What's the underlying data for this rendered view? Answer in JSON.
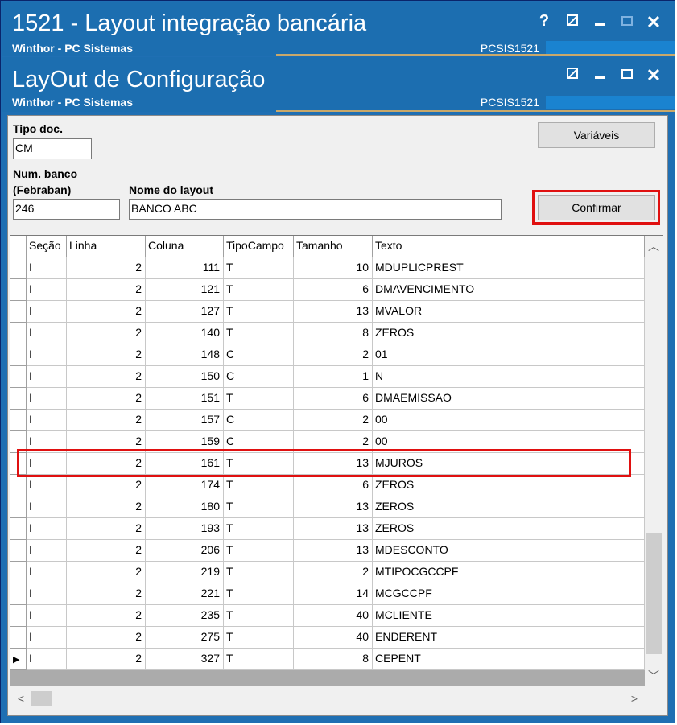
{
  "outer_window": {
    "title": "1521 - Layout integração bancária",
    "subtitle": "Winthor - PC Sistemas",
    "code": "PCSIS1521",
    "help_label": "?"
  },
  "inner_window": {
    "title": "LayOut de Configuração",
    "subtitle": "Winthor - PC Sistemas",
    "code": "PCSIS1521"
  },
  "form": {
    "tipo_doc_label": "Tipo doc.",
    "tipo_doc_value": "CM",
    "num_banco_label_1": "Num. banco",
    "num_banco_label_2": "(Febraban)",
    "num_banco_value": "246",
    "nome_layout_label": "Nome do layout",
    "nome_layout_value": "BANCO ABC",
    "variaveis_label": "Variáveis",
    "confirmar_label": "Confirmar"
  },
  "grid": {
    "columns": [
      "Seção",
      "Linha",
      "Coluna",
      "TipoCampo",
      "Tamanho",
      "Texto"
    ],
    "rows": [
      [
        "I",
        "2",
        "111",
        "T",
        "10",
        "MDUPLICPREST"
      ],
      [
        "I",
        "2",
        "121",
        "T",
        "6",
        "DMAVENCIMENTO"
      ],
      [
        "I",
        "2",
        "127",
        "T",
        "13",
        "MVALOR"
      ],
      [
        "I",
        "2",
        "140",
        "T",
        "8",
        "ZEROS"
      ],
      [
        "I",
        "2",
        "148",
        "C",
        "2",
        "01"
      ],
      [
        "I",
        "2",
        "150",
        "C",
        "1",
        "N"
      ],
      [
        "I",
        "2",
        "151",
        "T",
        "6",
        "DMAEMISSAO"
      ],
      [
        "I",
        "2",
        "157",
        "C",
        "2",
        "00"
      ],
      [
        "I",
        "2",
        "159",
        "C",
        "2",
        "00"
      ],
      [
        "I",
        "2",
        "161",
        "T",
        "13",
        "MJUROS"
      ],
      [
        "I",
        "2",
        "174",
        "T",
        "6",
        "ZEROS"
      ],
      [
        "I",
        "2",
        "180",
        "T",
        "13",
        "ZEROS"
      ],
      [
        "I",
        "2",
        "193",
        "T",
        "13",
        "ZEROS"
      ],
      [
        "I",
        "2",
        "206",
        "T",
        "13",
        "MDESCONTO"
      ],
      [
        "I",
        "2",
        "219",
        "T",
        "2",
        "MTIPOCGCCPF"
      ],
      [
        "I",
        "2",
        "221",
        "T",
        "14",
        "MCGCCPF"
      ],
      [
        "I",
        "2",
        "235",
        "T",
        "40",
        "MCLIENTE"
      ],
      [
        "I",
        "2",
        "275",
        "T",
        "40",
        "ENDERENT"
      ],
      [
        "I",
        "2",
        "327",
        "T",
        "8",
        "CEPENT"
      ]
    ],
    "highlighted_row_index": 9,
    "current_row_index": 18
  },
  "colors": {
    "titlebar": "#1c6eb0",
    "highlight": "#e01010"
  }
}
